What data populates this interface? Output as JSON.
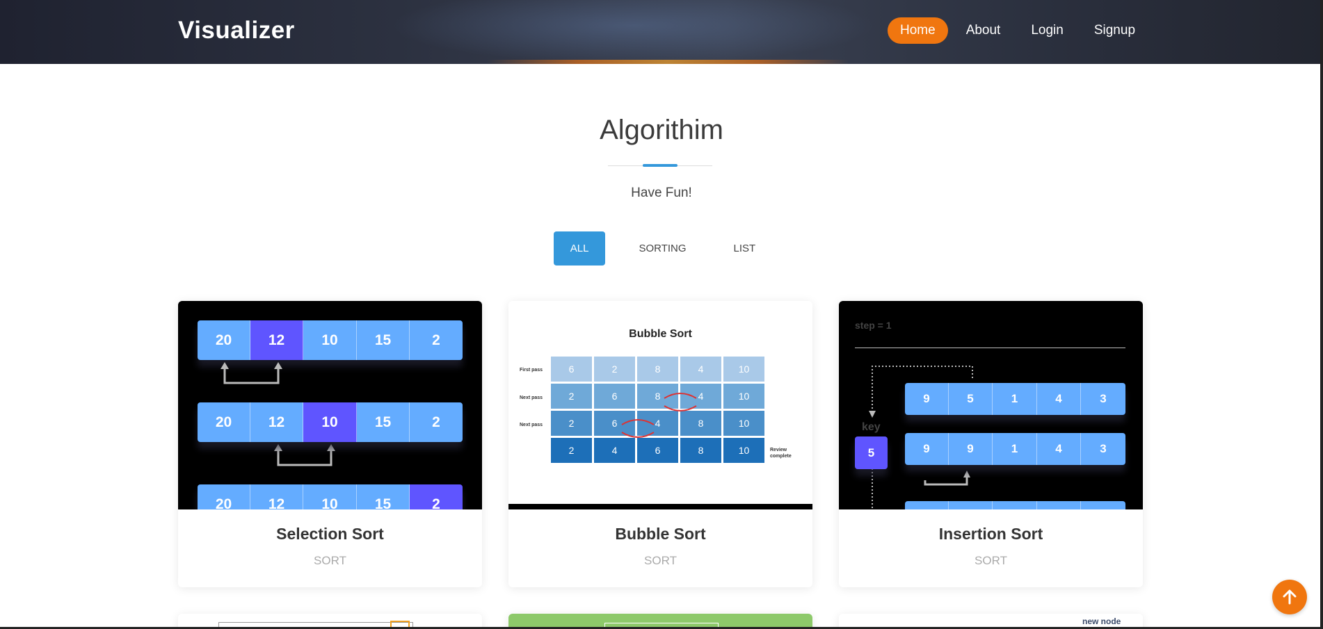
{
  "header": {
    "brand": "Visualizer",
    "nav": [
      "Home",
      "About",
      "Login",
      "Signup"
    ],
    "active_nav": "Home",
    "accent": "#f0760f"
  },
  "section": {
    "title": "Algorithim",
    "subtitle": "Have Fun!",
    "filters": [
      "ALL",
      "SORTING",
      "LIST"
    ],
    "active_filter": "ALL",
    "filter_color": "#3498db"
  },
  "cards": [
    {
      "name": "Selection Sort",
      "category": "SORT",
      "thumb": {
        "rows": [
          [
            "20",
            "12",
            "10",
            "15",
            "2"
          ],
          [
            "20",
            "12",
            "10",
            "15",
            "2"
          ],
          [
            "20",
            "12",
            "10",
            "15",
            "2"
          ]
        ]
      }
    },
    {
      "name": "Bubble Sort",
      "category": "SORT",
      "thumb": {
        "title": "Bubble Sort",
        "labels": [
          "First pass",
          "Next pass",
          "Next pass",
          "Review complete"
        ],
        "rows": [
          [
            "6",
            "2",
            "8",
            "4",
            "10"
          ],
          [
            "2",
            "6",
            "8",
            "4",
            "10"
          ],
          [
            "2",
            "6",
            "4",
            "8",
            "10"
          ],
          [
            "2",
            "4",
            "6",
            "8",
            "10"
          ]
        ]
      }
    },
    {
      "name": "Insertion Sort",
      "category": "SORT",
      "thumb": {
        "step": "step = 1",
        "key_label": "key",
        "key_value": "5",
        "rows": [
          [
            "9",
            "5",
            "1",
            "4",
            "3"
          ],
          [
            "9",
            "9",
            "1",
            "4",
            "3"
          ]
        ]
      }
    }
  ],
  "partial_cards": {
    "third_text": "new node"
  },
  "scroll_top_icon": "arrow-up-icon"
}
